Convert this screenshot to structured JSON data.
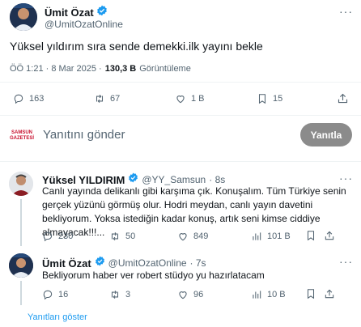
{
  "main_tweet": {
    "author_name": "Ümit Özat",
    "author_handle": "@UmitOzatOnline",
    "text": "Yüksel yıldırım sıra sende demekki.ilk yayını bekle",
    "timestamp": "ÖÖ 1:21 · 8 Mar 2025 ·",
    "views_count": "130,3 B",
    "views_label": "Görüntüleme",
    "stats": {
      "replies": "163",
      "retweets": "67",
      "likes": "1 B",
      "bookmarks": "15"
    }
  },
  "composer": {
    "avatar_text": "SAMSUN GAZETESİ",
    "placeholder": "Yanıtını gönder",
    "reply_button": "Yanıtla"
  },
  "replies": [
    {
      "author_name": "Yüksel YILDIRIM",
      "author_handle": "@YY_Samsun",
      "time": "· 8s",
      "text": "Canlı yayında delikanlı gibi karşıma çık. Konuşalım. Tüm Türkiye senin gerçek yüzünü görmüş olur. Hodri meydan, canlı yayın davetini bekliyorum. Yoksa istediğin kadar konuş, artık seni kimse ciddiye almayacak!!!...",
      "stats": {
        "replies": "230",
        "retweets": "50",
        "likes": "849",
        "views": "101 B"
      }
    },
    {
      "author_name": "Ümit Özat",
      "author_handle": "@UmitOzatOnline",
      "time": "· 7s",
      "text": "Bekliyorum haber ver robert stüdyo yu hazırlatacam",
      "stats": {
        "replies": "16",
        "retweets": "3",
        "likes": "96",
        "views": "10 B"
      }
    }
  ],
  "show_replies": "Yanıtları göster",
  "colors": {
    "verified": "#1d9bf0",
    "text": "#0f1419",
    "muted": "#536471",
    "reply_button": "#8b8b8b"
  }
}
